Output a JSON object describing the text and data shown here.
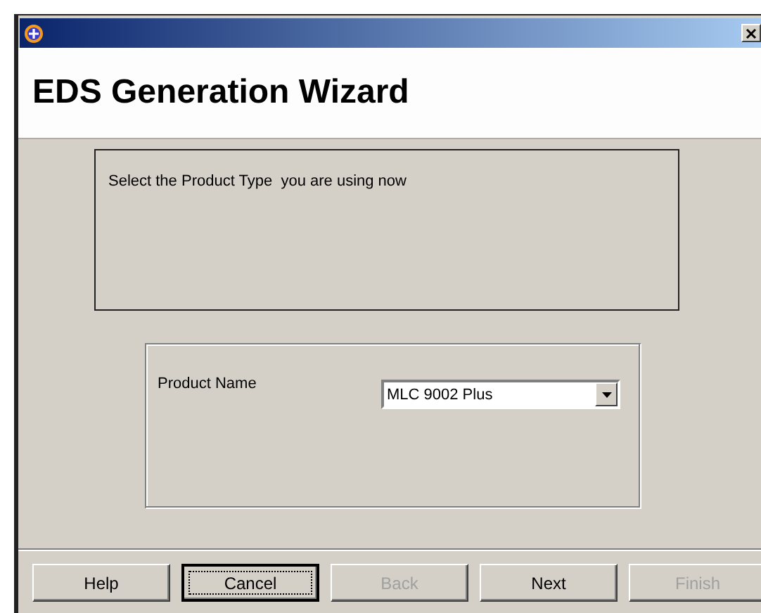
{
  "window": {
    "heading": "EDS Generation Wizard"
  },
  "instruction": "Select the Product Type  you are using now",
  "product": {
    "label": "Product Name",
    "value": "MLC 9002 Plus"
  },
  "buttons": [
    {
      "label": "Help",
      "disabled": false,
      "focused": false
    },
    {
      "label": "Cancel",
      "disabled": false,
      "focused": true
    },
    {
      "label": "Back",
      "disabled": true,
      "focused": false
    },
    {
      "label": "Next",
      "disabled": false,
      "focused": false
    },
    {
      "label": "Finish",
      "disabled": true,
      "focused": false
    }
  ]
}
